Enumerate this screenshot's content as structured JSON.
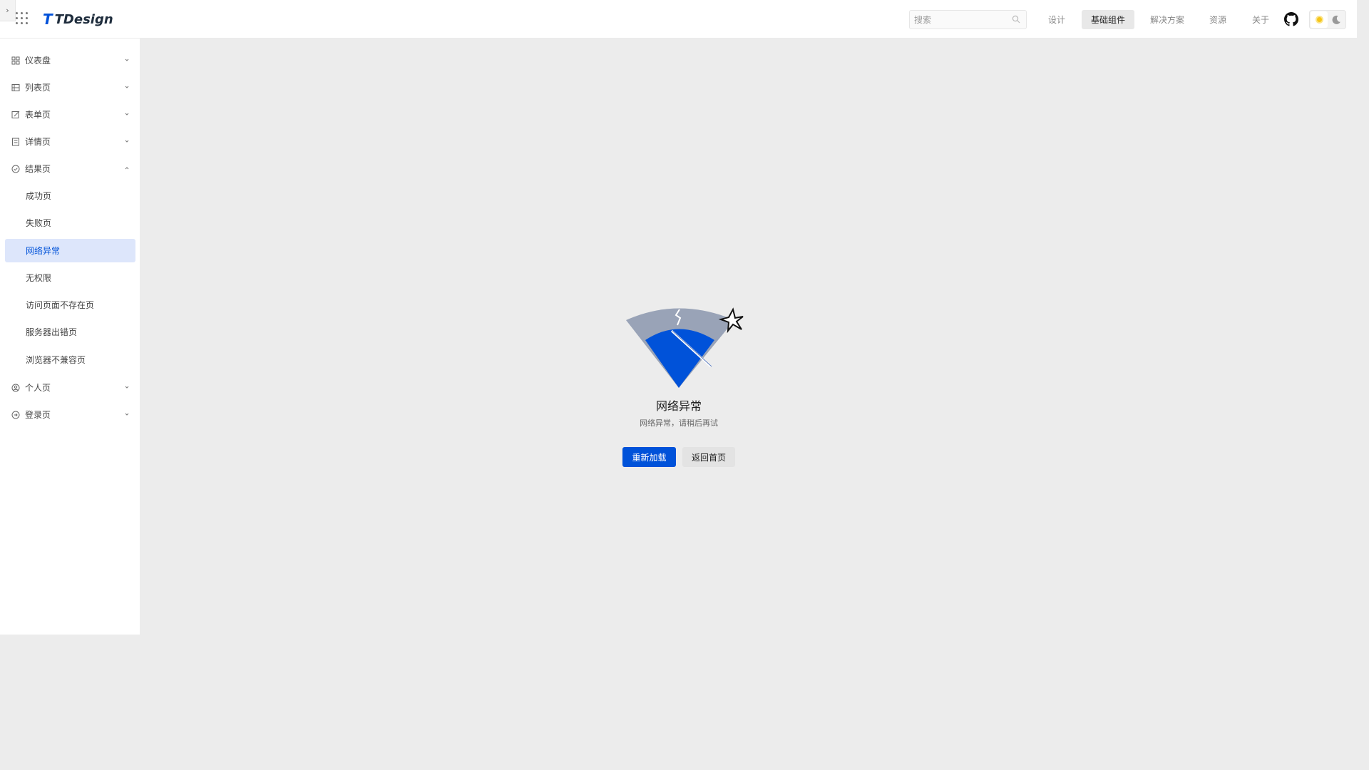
{
  "header": {
    "logo_text": "TDesign",
    "logo_mark": "T",
    "search_placeholder": "搜索",
    "nav": [
      {
        "label": "设计",
        "active": false
      },
      {
        "label": "基础组件",
        "active": true
      },
      {
        "label": "解决方案",
        "active": false
      },
      {
        "label": "资源",
        "active": false
      },
      {
        "label": "关于",
        "active": false
      }
    ],
    "left_toggle": "›"
  },
  "sidebar": {
    "items": [
      {
        "label": "仪表盘",
        "icon": "dashboard-icon",
        "expanded": false
      },
      {
        "label": "列表页",
        "icon": "list-icon",
        "expanded": false
      },
      {
        "label": "表单页",
        "icon": "form-edit-icon",
        "expanded": false
      },
      {
        "label": "详情页",
        "icon": "detail-icon",
        "expanded": false
      },
      {
        "label": "结果页",
        "icon": "check-circle-icon",
        "expanded": true,
        "children": [
          "成功页",
          "失败页",
          "网络异常",
          "无权限",
          "访问页面不存在页",
          "服务器出错页",
          "浏览器不兼容页"
        ],
        "active_child": "网络异常"
      },
      {
        "label": "个人页",
        "icon": "user-circle-icon",
        "expanded": false
      },
      {
        "label": "登录页",
        "icon": "login-icon",
        "expanded": false
      }
    ]
  },
  "content": {
    "title": "网络异常",
    "description": "网络异常，请稍后再试",
    "primary_button": "重新加载",
    "secondary_button": "返回首页"
  },
  "colors": {
    "brand": "#0052d9",
    "active_bg": "#dde6fb",
    "illustration_gray": "#99a3b7"
  }
}
